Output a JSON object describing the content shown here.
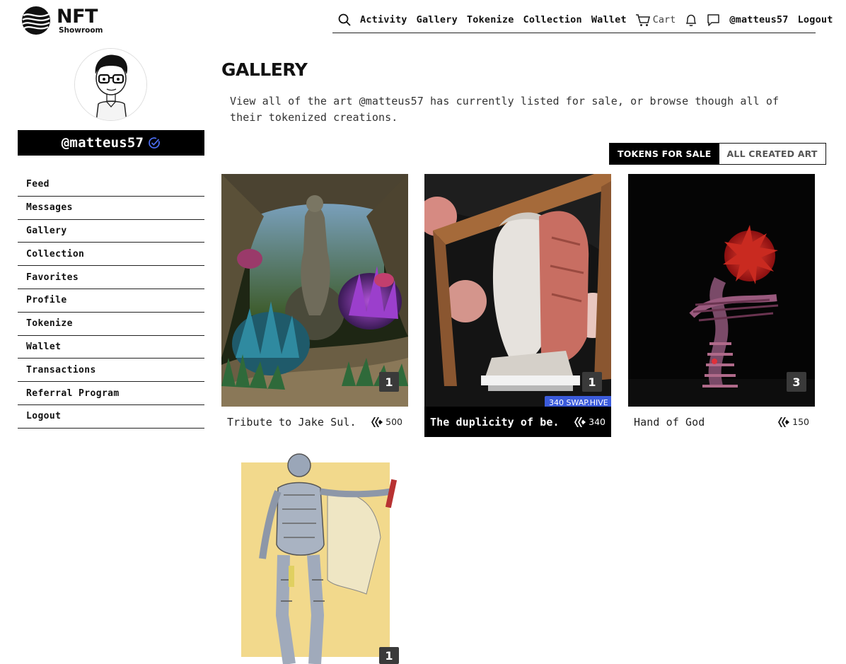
{
  "brand": {
    "name": "NFT",
    "sub": "Showroom"
  },
  "topnav": {
    "items": [
      "Activity",
      "Gallery",
      "Tokenize",
      "Collection",
      "Wallet"
    ],
    "cart_label": "Cart",
    "username": "@matteus57",
    "logout": "Logout",
    "icons": [
      "search-icon",
      "cart-icon",
      "bell-icon",
      "chat-icon"
    ]
  },
  "sidebar": {
    "username": "@matteus57",
    "verified_icon": "check-circle-icon",
    "verified_color": "#4c6ef5",
    "items": [
      "Feed",
      "Messages",
      "Gallery",
      "Collection",
      "Favorites",
      "Profile",
      "Tokenize",
      "Wallet",
      "Transactions",
      "Referral Program",
      "Logout"
    ]
  },
  "main": {
    "title": "GALLERY",
    "description": "View all of the art @matteus57 has currently listed for sale, or browse though all of their tokenized creations.",
    "toggle": {
      "active": "TOKENS FOR SALE",
      "inactive": "ALL CREATED ART"
    }
  },
  "cards": [
    {
      "title": "Tribute to Jake Sul...",
      "price": "500",
      "count": "1"
    },
    {
      "title": "The duplicity of be...",
      "price": "340",
      "count": "1",
      "tooltip": "340 SWAP.HIVE"
    },
    {
      "title": "Hand of God",
      "price": "150",
      "count": "3"
    },
    {
      "count": "1"
    }
  ],
  "colors": {
    "accent": "#000000",
    "tooltip": "#3b5bdb"
  }
}
